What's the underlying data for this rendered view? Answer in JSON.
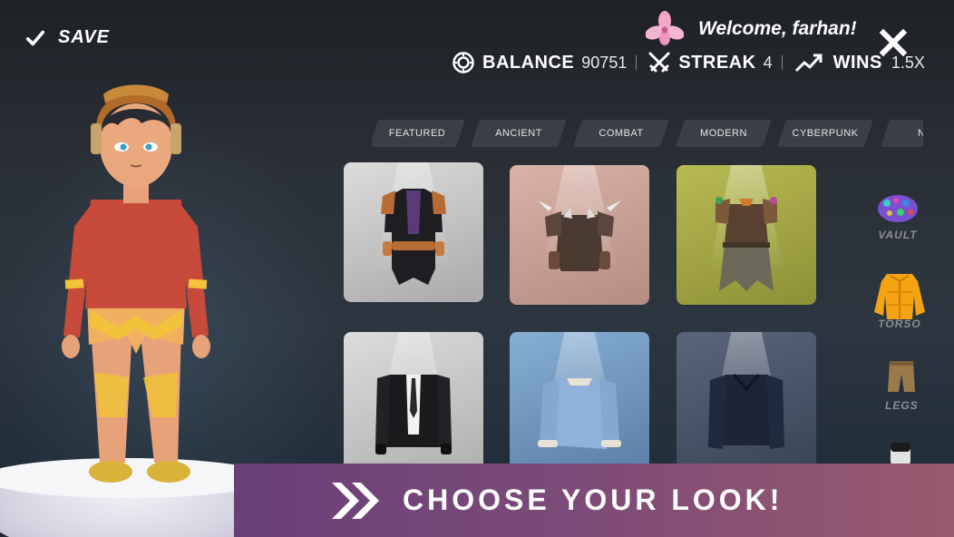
{
  "header": {
    "save_label": "SAVE",
    "welcome_text": "Welcome, farhan!",
    "stats": {
      "balance_label": "BALANCE",
      "balance_value": "90751",
      "streak_label": "STREAK",
      "streak_value": "4",
      "wins_label": "WINS",
      "wins_value": "1.5X"
    }
  },
  "tabs": [
    {
      "label": "FEATURED"
    },
    {
      "label": "ANCIENT"
    },
    {
      "label": "COMBAT"
    },
    {
      "label": "MODERN"
    },
    {
      "label": "CYBERPUNK"
    },
    {
      "label": "N"
    }
  ],
  "items": [
    {
      "name": "dark-jerkin",
      "bg": "#cfcfcf"
    },
    {
      "name": "horned-armor",
      "bg": "#cfa69b"
    },
    {
      "name": "tribal-armor",
      "bg": "#a6a848"
    },
    {
      "name": "black-suit",
      "bg": "#cfcfcf"
    },
    {
      "name": "blue-sweater",
      "bg": "#7fa3c8"
    },
    {
      "name": "navy-hoodie",
      "bg": "#4a5466"
    }
  ],
  "rail": {
    "vault_label": "VAULT",
    "torso_label": "TORSO",
    "legs_label": "LEGS"
  },
  "banner": {
    "text": "CHOOSE YOUR LOOK!"
  },
  "colors": {
    "banner_start": "#6a3f78",
    "banner_end": "#9a5a6f",
    "tab_bg": "#3a3f47",
    "muted_label": "#8a8f96"
  }
}
